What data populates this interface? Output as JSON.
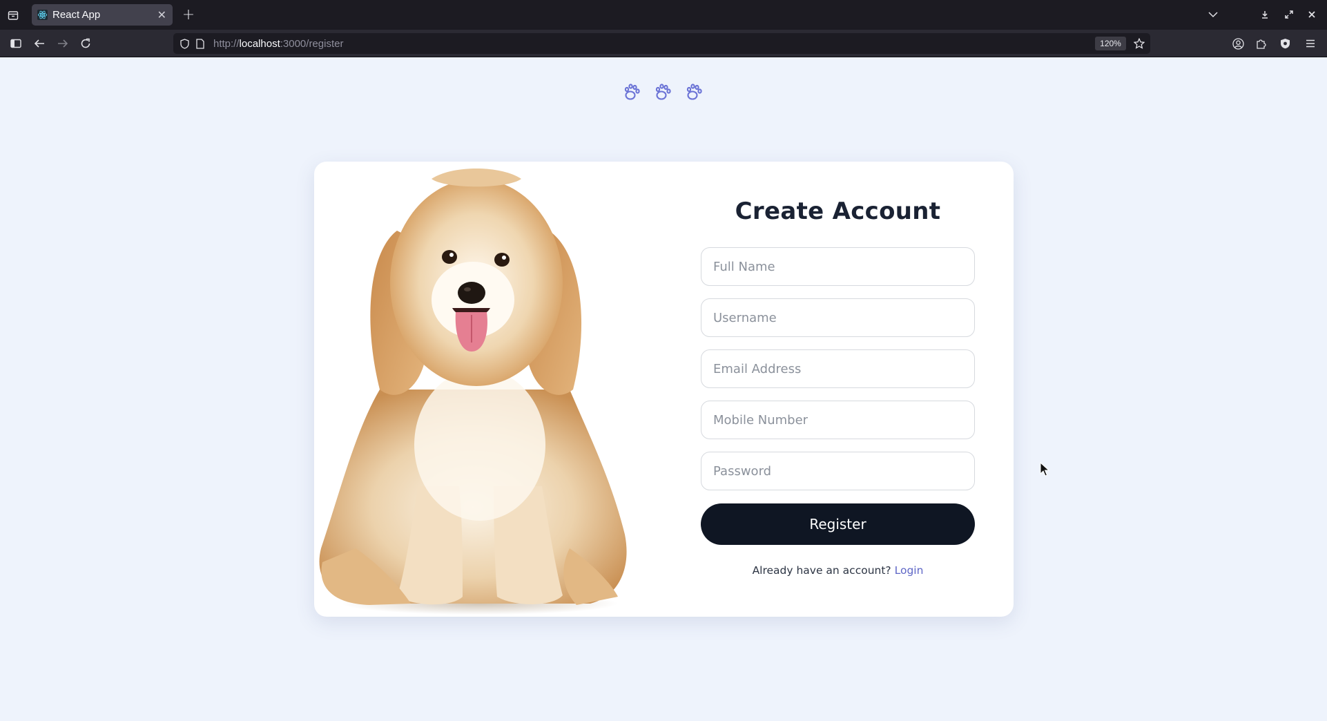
{
  "browser": {
    "tab": {
      "title": "React App"
    },
    "url": {
      "prefix": "http://",
      "host": "localhost",
      "rest": ":3000/register"
    },
    "zoom": "120%"
  },
  "page": {
    "header_icons": [
      "paw-icon",
      "paw-icon",
      "paw-icon"
    ],
    "accent_color": "#6b73d6",
    "form": {
      "title": "Create Account",
      "fields": [
        {
          "name": "full-name",
          "placeholder": "Full Name",
          "value": ""
        },
        {
          "name": "username",
          "placeholder": "Username",
          "value": ""
        },
        {
          "name": "email-address",
          "placeholder": "Email Address",
          "value": ""
        },
        {
          "name": "mobile-number",
          "placeholder": "Mobile Number",
          "value": ""
        },
        {
          "name": "password",
          "placeholder": "Password",
          "value": ""
        }
      ],
      "submit_label": "Register",
      "login_prompt": "Already have an account?",
      "login_link": "Login"
    }
  }
}
